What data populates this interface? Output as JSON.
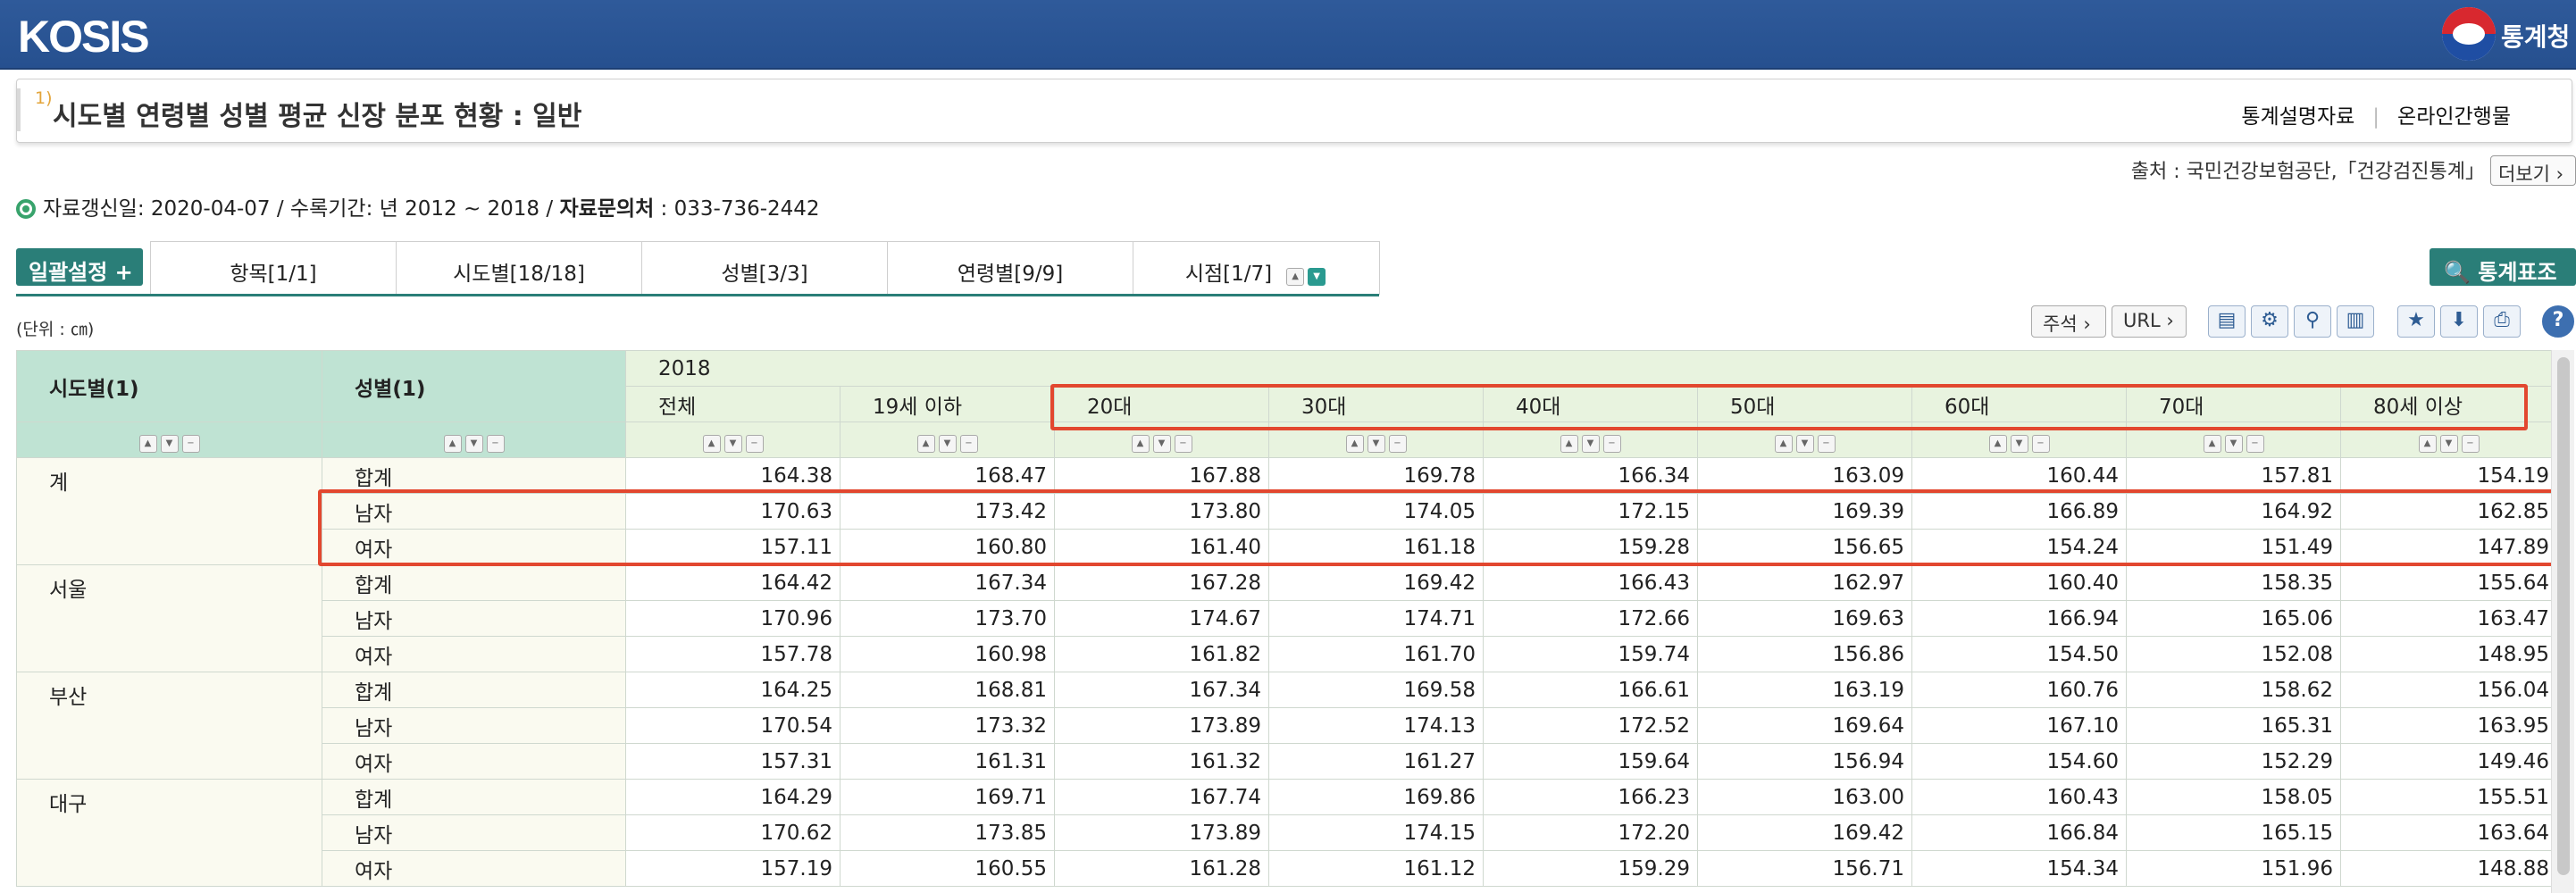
{
  "header": {
    "logo": "KOSIS",
    "agency": "통계청"
  },
  "title": {
    "sup": "1)",
    "text": "시도별 연령별 성별 평균 신장 분포 현황 : 일반",
    "links": [
      "통계설명자료",
      "온라인간행물"
    ]
  },
  "source": {
    "text": "출처 : 국민건강보험공단,「건강검진통계」",
    "more": "더보기"
  },
  "info": {
    "updated_label": "자료갱신일",
    "updated_value": "2020-04-07",
    "period_label": "수록기간",
    "period_value": "년 2012 ~ 2018",
    "contact_label": "자료문의처",
    "contact_value": "033-736-2442"
  },
  "toolbar": {
    "batch": "일괄설정 +",
    "query": "통계표조회",
    "tabs": [
      "항목[1/1]",
      "시도별[18/18]",
      "성별[3/3]",
      "연령별[9/9]",
      "시점[1/7]"
    ],
    "unit": "(단위 : ㎝)",
    "note_btn": "주석 ›",
    "url_btn": "URL ›",
    "icons": [
      "layout-icon",
      "gear-icon",
      "chart-settings-icon",
      "bar-chart-icon",
      "star-icon",
      "download-icon",
      "print-icon",
      "help-icon"
    ]
  },
  "table": {
    "col_region": "시도별(1)",
    "col_sex": "성별(1)",
    "year": "2018",
    "ages": [
      "전체",
      "19세 이하",
      "20대",
      "30대",
      "40대",
      "50대",
      "60대",
      "70대",
      "80세 이상"
    ],
    "groups": [
      {
        "region": "계",
        "rows": [
          {
            "sex": "합계",
            "v": [
              "164.38",
              "168.47",
              "167.88",
              "169.78",
              "166.34",
              "163.09",
              "160.44",
              "157.81",
              "154.19"
            ]
          },
          {
            "sex": "남자",
            "v": [
              "170.63",
              "173.42",
              "173.80",
              "174.05",
              "172.15",
              "169.39",
              "166.89",
              "164.92",
              "162.85"
            ]
          },
          {
            "sex": "여자",
            "v": [
              "157.11",
              "160.80",
              "161.40",
              "161.18",
              "159.28",
              "156.65",
              "154.24",
              "151.49",
              "147.89"
            ]
          }
        ]
      },
      {
        "region": "서울",
        "rows": [
          {
            "sex": "합계",
            "v": [
              "164.42",
              "167.34",
              "167.28",
              "169.42",
              "166.43",
              "162.97",
              "160.40",
              "158.35",
              "155.64"
            ]
          },
          {
            "sex": "남자",
            "v": [
              "170.96",
              "173.70",
              "174.67",
              "174.71",
              "172.66",
              "169.63",
              "166.94",
              "165.06",
              "163.47"
            ]
          },
          {
            "sex": "여자",
            "v": [
              "157.78",
              "160.98",
              "161.82",
              "161.70",
              "159.74",
              "156.86",
              "154.50",
              "152.08",
              "148.95"
            ]
          }
        ]
      },
      {
        "region": "부산",
        "rows": [
          {
            "sex": "합계",
            "v": [
              "164.25",
              "168.81",
              "167.34",
              "169.58",
              "166.61",
              "163.19",
              "160.76",
              "158.62",
              "156.04"
            ]
          },
          {
            "sex": "남자",
            "v": [
              "170.54",
              "173.32",
              "173.89",
              "174.13",
              "172.52",
              "169.64",
              "167.10",
              "165.31",
              "163.95"
            ]
          },
          {
            "sex": "여자",
            "v": [
              "157.31",
              "161.31",
              "161.32",
              "161.27",
              "159.64",
              "156.94",
              "154.60",
              "152.29",
              "149.46"
            ]
          }
        ]
      },
      {
        "region": "대구",
        "rows": [
          {
            "sex": "합계",
            "v": [
              "164.29",
              "169.71",
              "167.74",
              "169.86",
              "166.23",
              "163.00",
              "160.43",
              "158.05",
              "155.51"
            ]
          },
          {
            "sex": "남자",
            "v": [
              "170.62",
              "173.85",
              "173.89",
              "174.15",
              "172.20",
              "169.42",
              "166.84",
              "165.15",
              "163.64"
            ]
          },
          {
            "sex": "여자",
            "v": [
              "157.19",
              "160.55",
              "161.28",
              "161.12",
              "159.29",
              "156.71",
              "154.34",
              "151.96",
              "148.88"
            ]
          }
        ]
      }
    ]
  },
  "colors": {
    "topbar": "#2f5a9a",
    "teal": "#2a7e78",
    "highlight": "#e2472f",
    "header_green": "#bfe3d3",
    "header_light": "#e8f3df"
  }
}
